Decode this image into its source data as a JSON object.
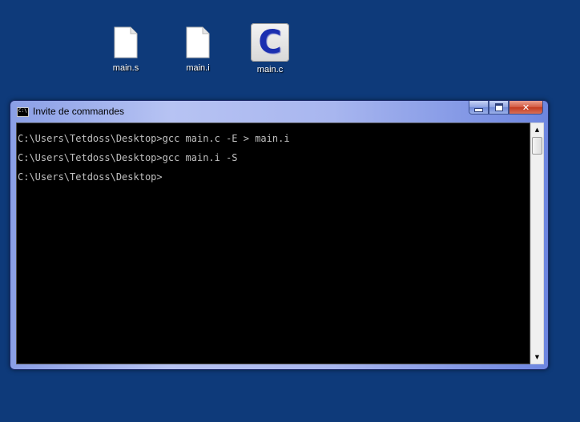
{
  "desktop": {
    "icons": [
      {
        "label": "main.s",
        "icon": "file-icon"
      },
      {
        "label": "main.i",
        "icon": "file-icon"
      },
      {
        "label": "main.c",
        "icon": "c-source-file-icon",
        "glyph": "C"
      }
    ]
  },
  "window": {
    "title": "Invite de commandes",
    "icon": "cmd-icon",
    "icon_text": "C:\\",
    "buttons": {
      "minimize": "minimize-icon",
      "maximize": "maximize-icon",
      "close": "✕"
    }
  },
  "console": {
    "lines": [
      "C:\\Users\\Tetdoss\\Desktop>gcc main.c -E > main.i",
      "C:\\Users\\Tetdoss\\Desktop>gcc main.i -S",
      "C:\\Users\\Tetdoss\\Desktop>"
    ]
  },
  "scrollbar": {
    "up_arrow": "▲",
    "down_arrow": "▼"
  },
  "colors": {
    "desktop_background": "#0e3a7a",
    "console_background": "#000000",
    "console_text": "#c0c0c0",
    "close_button": "#c23a1f"
  }
}
